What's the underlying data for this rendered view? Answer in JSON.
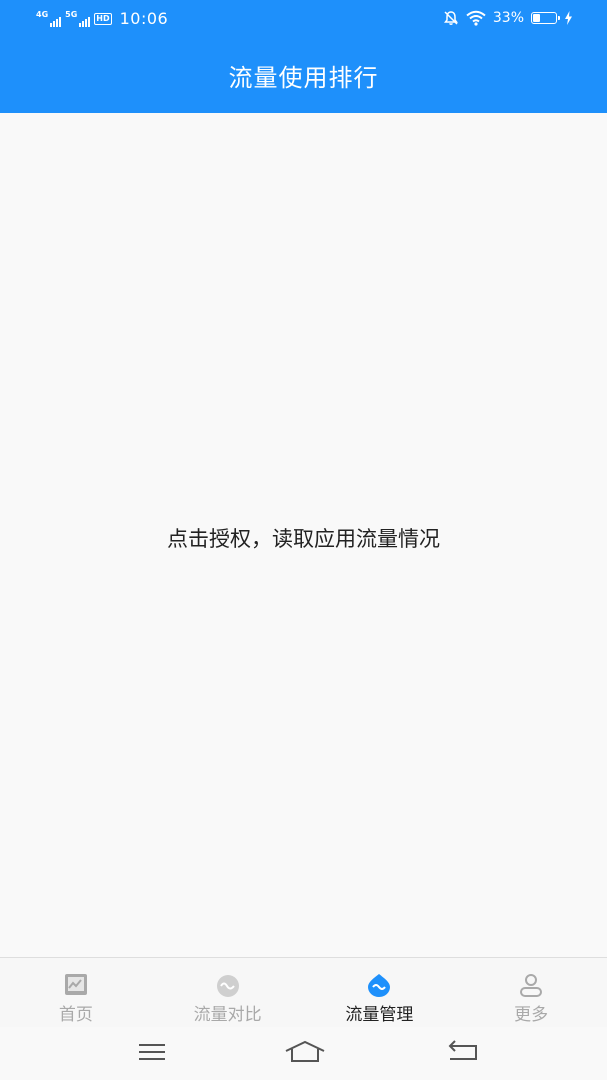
{
  "status_bar": {
    "sim1_network": "4G",
    "sim2_network": "5G",
    "hd_badge": "HD",
    "time": "10:06",
    "battery_percent": "33%",
    "battery_level": 0.33
  },
  "header": {
    "title": "流量使用排行"
  },
  "main": {
    "auth_prompt": "点击授权，读取应用流量情况"
  },
  "tabs": [
    {
      "label": "首页",
      "icon": "chart-box-icon",
      "active": false
    },
    {
      "label": "流量对比",
      "icon": "cloud-wave-icon",
      "active": false
    },
    {
      "label": "流量管理",
      "icon": "water-drop-wave-icon",
      "active": true
    },
    {
      "label": "更多",
      "icon": "person-icon",
      "active": false
    }
  ],
  "colors": {
    "primary": "#1e90fb",
    "tab_inactive": "#a9a9a9",
    "tab_active": "#222222",
    "background": "#f9f9f9"
  }
}
